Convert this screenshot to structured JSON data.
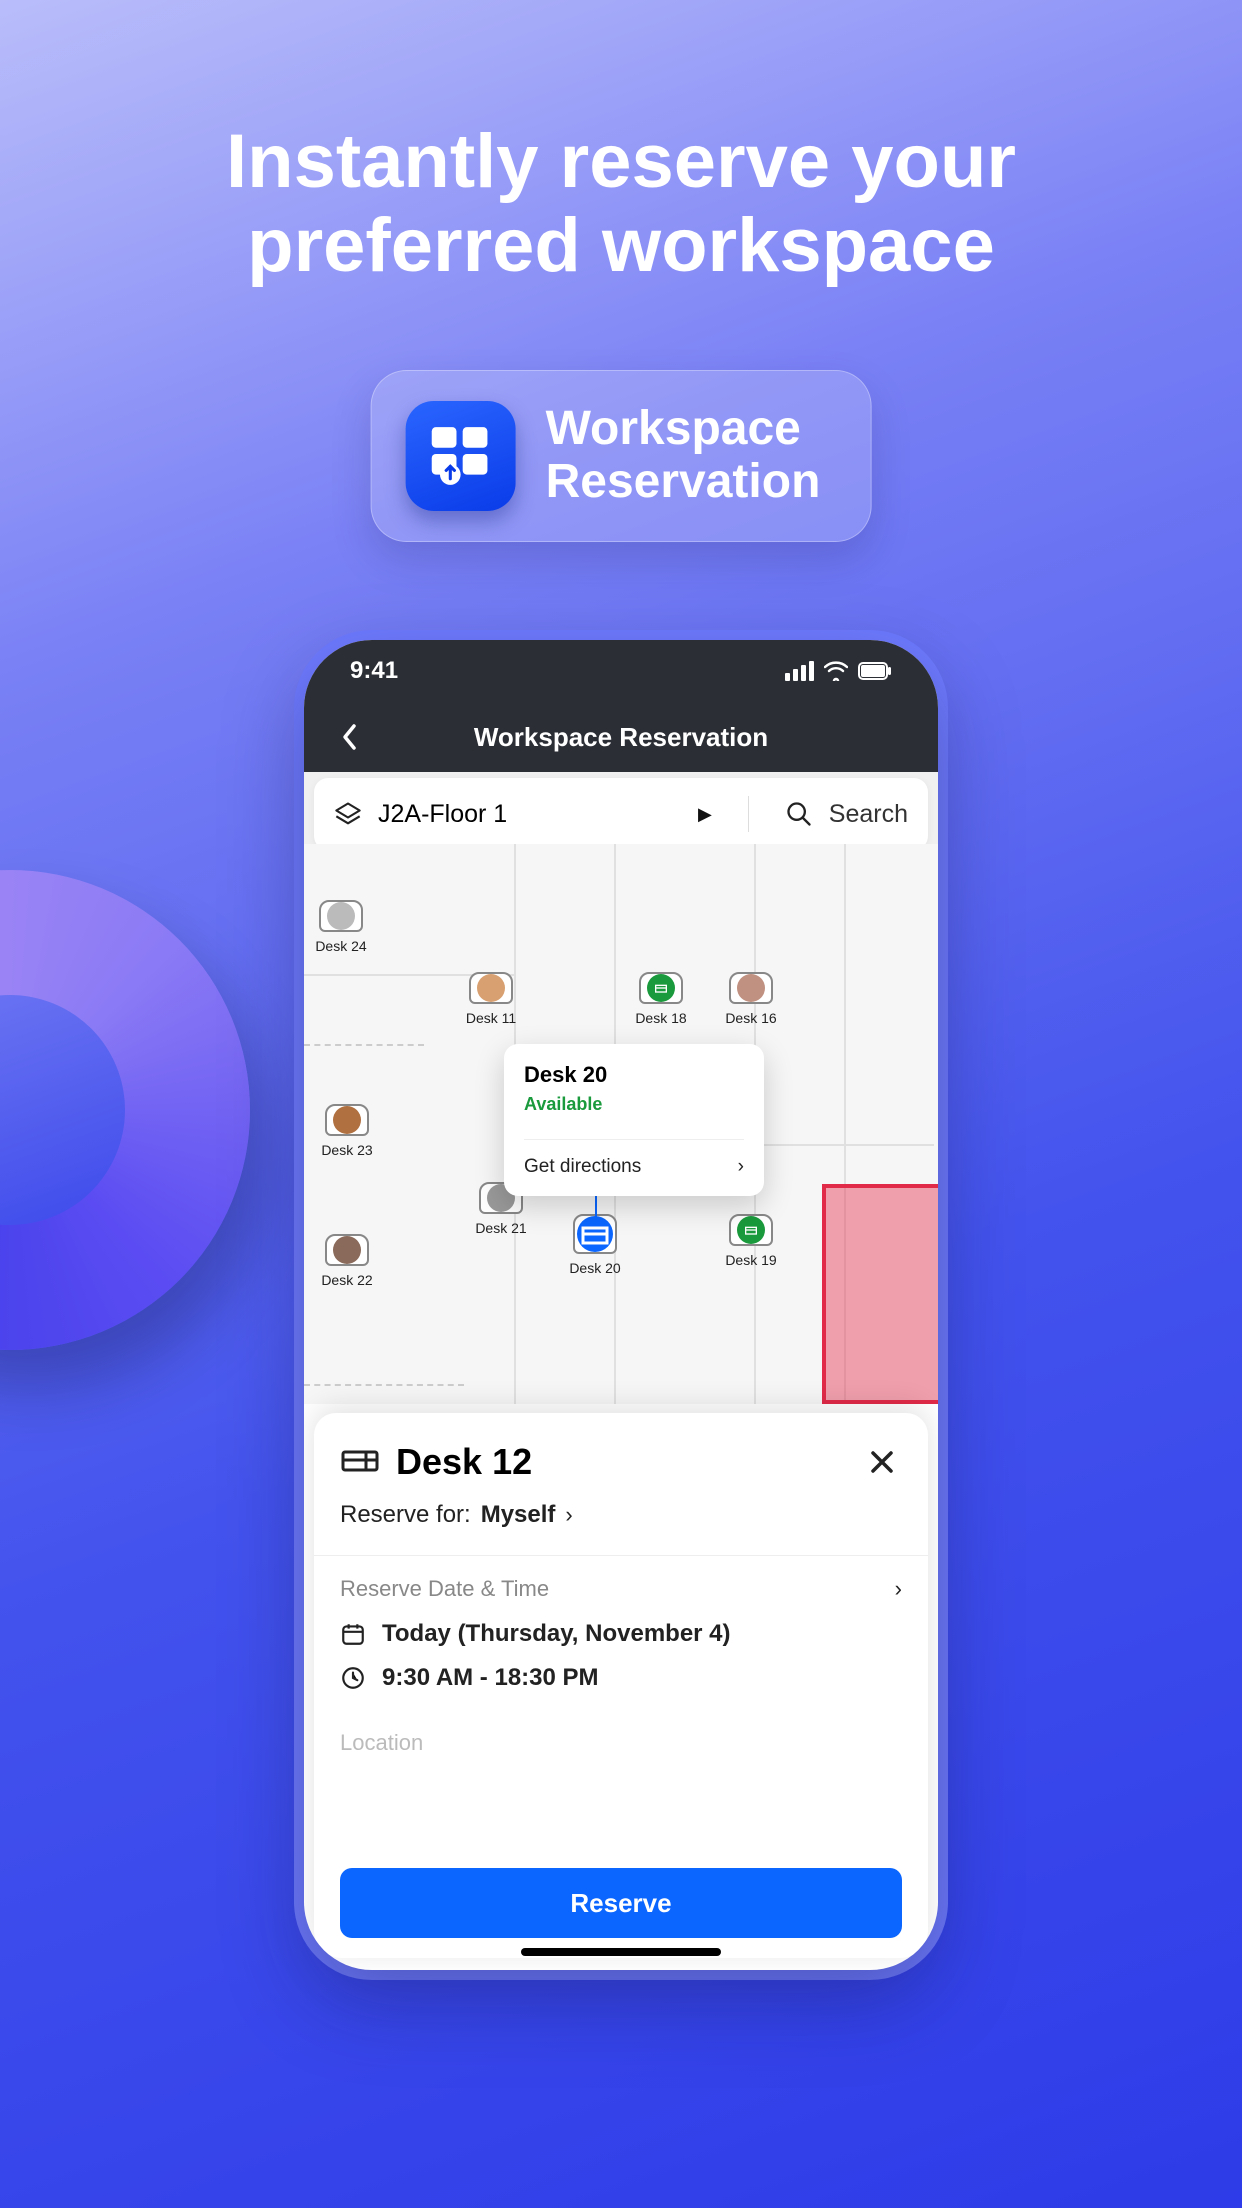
{
  "hero": {
    "headline_line1": "Instantly reserve your",
    "headline_line2": "preferred workspace"
  },
  "badge": {
    "title_line1": "Workspace",
    "title_line2": "Reservation"
  },
  "status": {
    "time": "9:41"
  },
  "header": {
    "title": "Workspace Reservation"
  },
  "floorbar": {
    "floor_name": "J2A-Floor 1",
    "search_label": "Search"
  },
  "map": {
    "desks": {
      "d24": "Desk  24",
      "d11": "Desk  11",
      "d18": "Desk  18",
      "d16": "Desk  16",
      "d23": "Desk  23",
      "d21": "Desk  21",
      "d20": "Desk  20",
      "d19": "Desk  19",
      "d22": "Desk  22"
    },
    "callout": {
      "title": "Desk 20",
      "status": "Available",
      "directions": "Get directions"
    }
  },
  "sheet": {
    "title": "Desk 12",
    "reserve_for_label": "Reserve for:",
    "reserve_for_value": "Myself",
    "section_label": "Reserve Date & Time",
    "date": "Today (Thursday, November 4)",
    "time": "9:30 AM - 18:30 PM",
    "location_label": "Location",
    "reserve_button": "Reserve"
  }
}
